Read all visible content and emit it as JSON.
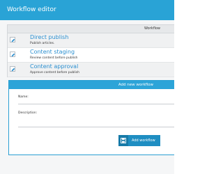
{
  "header": {
    "title": "Workflow editor"
  },
  "table": {
    "column_header": "Workflow",
    "rows": [
      {
        "name": "Direct publish",
        "description": "Publish articles."
      },
      {
        "name": "Content staging",
        "description": "Review content before publish"
      },
      {
        "name": "Content approval",
        "description": "Approve content before publish"
      }
    ]
  },
  "add_panel": {
    "title": "Add new workflow",
    "name_label": "Name:",
    "description_label": "Description:",
    "button_label": "Add workflow",
    "button_icon": "save-icon"
  },
  "colors": {
    "header_bg": "#29a3d6",
    "link": "#2a8fd0",
    "button_bg": "#1f8ec2"
  }
}
